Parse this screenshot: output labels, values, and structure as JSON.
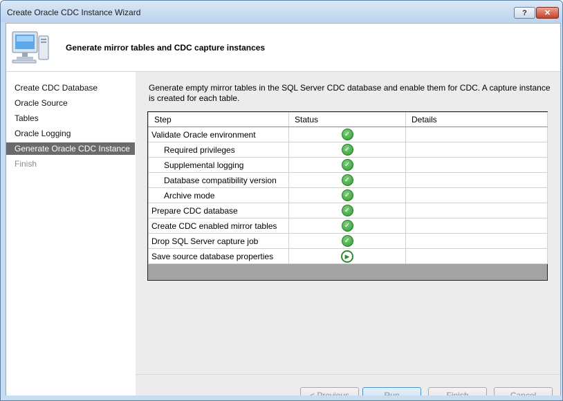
{
  "window": {
    "title": "Create Oracle CDC Instance Wizard",
    "help_label": "?",
    "close_label": "✕"
  },
  "header": {
    "title": "Generate mirror tables and CDC capture instances"
  },
  "sidebar": {
    "items": [
      {
        "label": "Create CDC Database",
        "state": "normal"
      },
      {
        "label": "Oracle Source",
        "state": "normal"
      },
      {
        "label": "Tables",
        "state": "normal"
      },
      {
        "label": "Oracle Logging",
        "state": "normal"
      },
      {
        "label": "Generate Oracle CDC Instance",
        "state": "selected"
      },
      {
        "label": "Finish",
        "state": "disabled"
      }
    ]
  },
  "main": {
    "description": "Generate empty mirror tables in the SQL Server CDC database and enable them for CDC.  A capture instance is created for each table.",
    "table": {
      "columns": [
        "Step",
        "Status",
        "Details"
      ],
      "rows": [
        {
          "step": "Validate Oracle environment",
          "indent": false,
          "status": "success",
          "details": ""
        },
        {
          "step": "Required privileges",
          "indent": true,
          "status": "success",
          "details": ""
        },
        {
          "step": "Supplemental logging",
          "indent": true,
          "status": "success",
          "details": ""
        },
        {
          "step": "Database compatibility version",
          "indent": true,
          "status": "success",
          "details": ""
        },
        {
          "step": "Archive mode",
          "indent": true,
          "status": "success",
          "details": ""
        },
        {
          "step": "Prepare CDC database",
          "indent": false,
          "status": "success",
          "details": ""
        },
        {
          "step": "Create CDC enabled mirror tables",
          "indent": false,
          "status": "success",
          "details": ""
        },
        {
          "step": "Drop SQL Server capture job",
          "indent": false,
          "status": "success",
          "details": ""
        },
        {
          "step": "Save source database properties",
          "indent": false,
          "status": "in-progress",
          "details": ""
        }
      ]
    }
  },
  "buttons": {
    "previous": "< Previous",
    "run": "Run",
    "finish": "Finish",
    "cancel": "Cancel"
  },
  "icons": {
    "success": "check-circle-icon",
    "in_progress": "play-circle-icon",
    "header": "computer-icon"
  },
  "colors": {
    "success": "#2e9a2e",
    "selected_nav": "#6b6b6b",
    "title_bar": "#c8dcf2"
  }
}
